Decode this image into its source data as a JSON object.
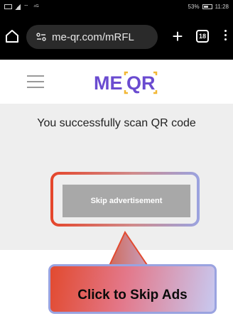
{
  "status_bar": {
    "left_text": "⁴ᴳ",
    "battery_text": "53%",
    "time": "11:28"
  },
  "browser": {
    "url": "me-qr.com/mRFL",
    "tab_count": "18",
    "icons": [
      "home-icon",
      "site-info-icon",
      "plus-icon",
      "tabs-icon",
      "more-vert-icon"
    ]
  },
  "site": {
    "logo_text_left": "ME",
    "logo_text_right": "QR",
    "icons": [
      "hamburger-menu-icon"
    ]
  },
  "content": {
    "success_message": "You successfully scan QR code",
    "skip_button_label": "Skip advertisement"
  },
  "annotation": {
    "callout_text": "Click to Skip Ads"
  },
  "colors": {
    "accent_red": "#e5452a",
    "accent_purple": "#9aa3e0",
    "logo_purple": "#6a4bd0",
    "logo_yellow": "#f2b733",
    "panel_bg": "#eeeeee",
    "button_gray": "#a8a8a8"
  }
}
